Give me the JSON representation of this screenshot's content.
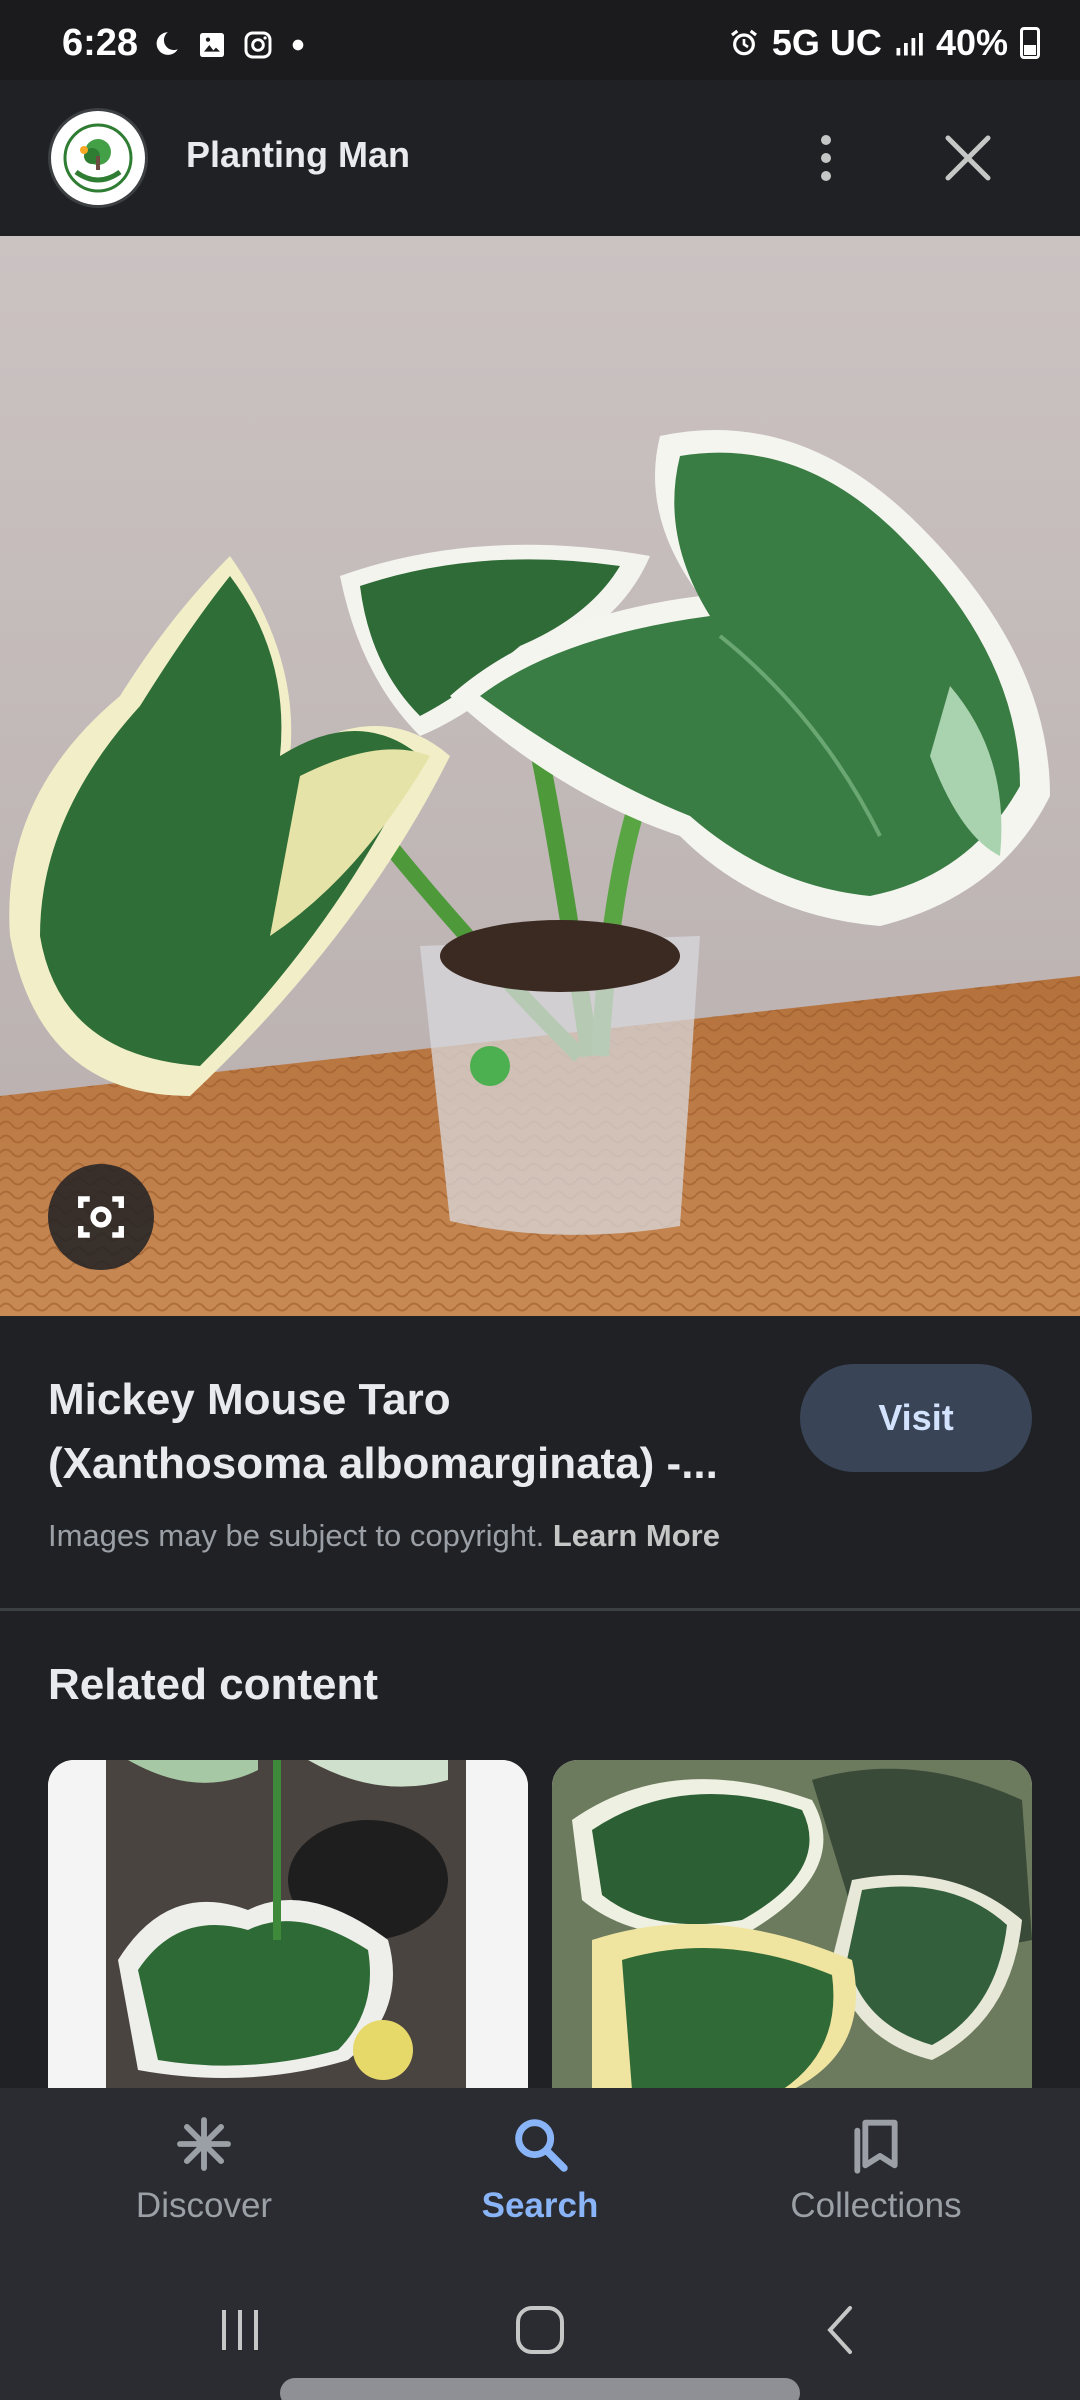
{
  "status_bar": {
    "time": "6:28",
    "network": "5G UC",
    "battery": "40%"
  },
  "header": {
    "site_name": "Planting Man"
  },
  "result": {
    "title_line1": "Mickey Mouse Taro",
    "title_line2": "(Xanthosoma albomarginata) -...",
    "visit_label": "Visit",
    "copyright_text": "Images may be subject to copyright.",
    "learn_more_label": "Learn More"
  },
  "related": {
    "heading": "Related content"
  },
  "bottom_nav": {
    "items": [
      {
        "label": "Discover",
        "icon": "asterisk-icon"
      },
      {
        "label": "Search",
        "icon": "search-icon"
      },
      {
        "label": "Collections",
        "icon": "collections-icon"
      }
    ],
    "active": "Search"
  },
  "colors": {
    "accent": "#8ab4f8",
    "background": "#202124",
    "visit_button": "#394457"
  }
}
